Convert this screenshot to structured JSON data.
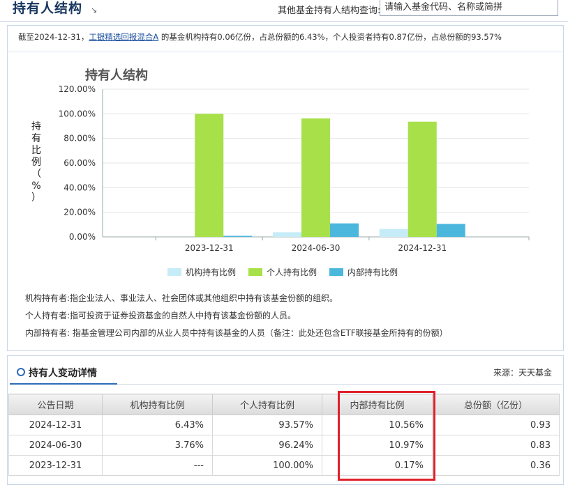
{
  "header": {
    "title": "持有人结构",
    "arrow_icon": "↘",
    "lookup_label": "其他基金持有人结构查询:",
    "lookup_placeholder": "请输入基金代码、名称或简拼"
  },
  "summary": {
    "prefix": "截至2024-12-31，",
    "fund_name": "工银精选回报混合A",
    "suffix": " 的基金机构持有0.06亿份，占总份额的6.43%，个人投资者持有0.87亿份，占总份额的93.57%"
  },
  "chart_data": {
    "type": "bar",
    "title": "持有人结构",
    "ylabel": "持有比例（%）",
    "ylim": [
      0,
      120
    ],
    "ytick_labels": [
      "0.00%",
      "20.00%",
      "40.00%",
      "60.00%",
      "80.00%",
      "100.00%",
      "120.00%"
    ],
    "categories": [
      "2023-12-31",
      "2024-06-30",
      "2024-12-31"
    ],
    "series": [
      {
        "name": "机构持有比例",
        "values": [
          0,
          3.76,
          6.43
        ],
        "color": "#c6ecf8"
      },
      {
        "name": "个人持有比例",
        "values": [
          100.0,
          96.24,
          93.57
        ],
        "color": "#a8e04a"
      },
      {
        "name": "内部持有比例",
        "values": [
          0.17,
          10.97,
          10.56
        ],
        "color": "#4bb7dd"
      }
    ],
    "legend_position": "bottom",
    "grid": true
  },
  "definitions": [
    {
      "term": "机构持有者:",
      "text": "指企业法人、事业法人、社会团体或其他组织中持有该基金份额的组织。"
    },
    {
      "term": "个人持有者:",
      "text": "指可投资于证券投资基金的自然人中持有该基金份额的人员。"
    },
    {
      "term": "内部持有者:",
      "text": " 指基金管理公司内部的从业人员中持有该基金的人员（备注：此处还包含ETF联接基金所持有的份额）"
    }
  ],
  "detail": {
    "title": "持有人变动详情",
    "source": "来源：天天基金",
    "columns": [
      "公告日期",
      "机构持有比例",
      "个人持有比例",
      "内部持有比例",
      "总份额（亿份）"
    ],
    "rows": [
      [
        "2024-12-31",
        "6.43%",
        "93.57%",
        "10.56%",
        "0.93"
      ],
      [
        "2024-06-30",
        "3.76%",
        "96.24%",
        "10.97%",
        "0.83"
      ],
      [
        "2023-12-31",
        "---",
        "100.00%",
        "0.17%",
        "0.36"
      ]
    ],
    "highlight_color": "#e0202a"
  }
}
